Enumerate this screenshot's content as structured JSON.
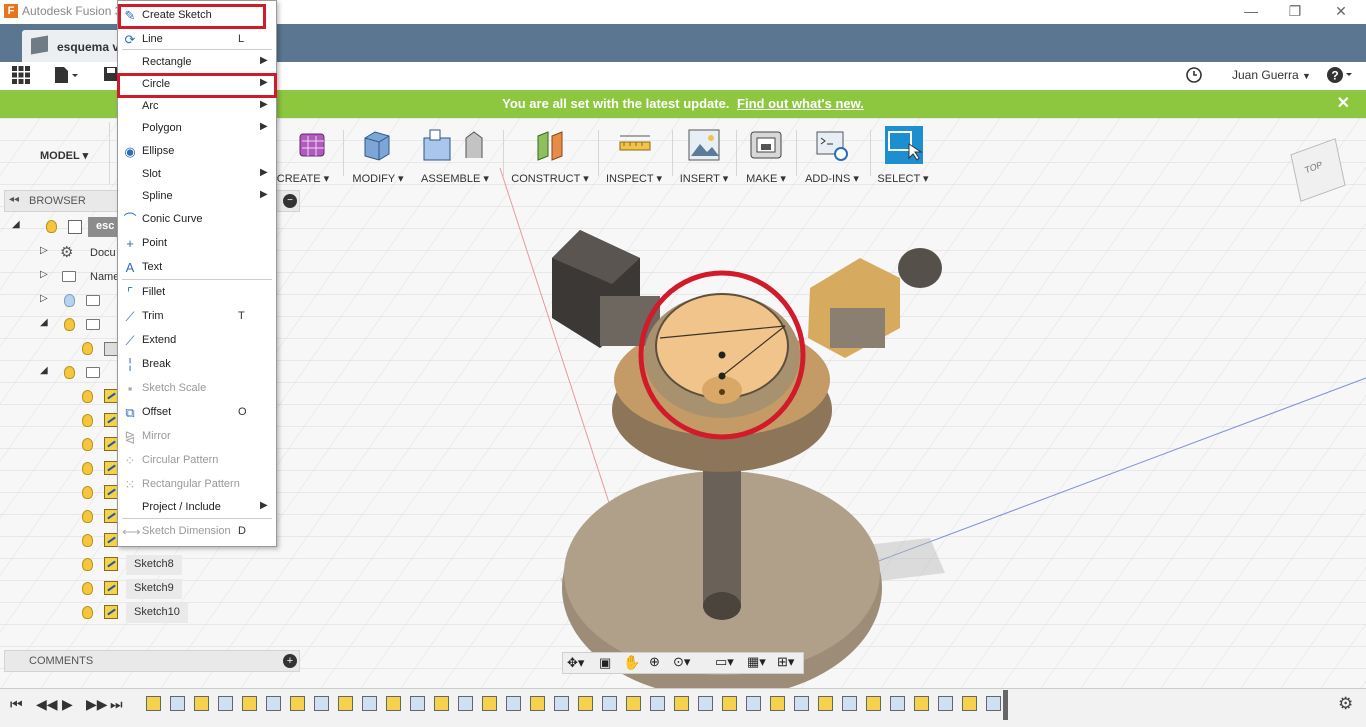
{
  "window": {
    "title": "Autodesk Fusion 360",
    "minimize_icon": "minimize-icon",
    "maximize_icon": "restore-icon",
    "close_icon": "close-icon"
  },
  "document_tab": {
    "label": "esquema v"
  },
  "quick_access": {
    "user_name": "Juan Guerra",
    "help_label": "?"
  },
  "banner": {
    "message": "You are all set with the latest update.",
    "link": "Find out what's new.",
    "close": "✕",
    "color": "#8dc63f"
  },
  "toolbar": {
    "workspace": "MODEL",
    "groups": [
      {
        "label": "CREATE"
      },
      {
        "label": "MODIFY"
      },
      {
        "label": "ASSEMBLE"
      },
      {
        "label": "CONSTRUCT"
      },
      {
        "label": "INSPECT"
      },
      {
        "label": "INSERT"
      },
      {
        "label": "MAKE"
      },
      {
        "label": "ADD-INS"
      },
      {
        "label": "SELECT"
      }
    ]
  },
  "browser": {
    "title": "BROWSER",
    "root_label": "esc",
    "rows": [
      {
        "label": "Docu"
      },
      {
        "label": "Name"
      }
    ],
    "sketches": [
      "Sketch8",
      "Sketch9",
      "Sketch10"
    ]
  },
  "comments": {
    "title": "COMMENTS"
  },
  "sketch_menu": {
    "items": [
      {
        "label": "Create Sketch",
        "shortcut": "",
        "submenu": false,
        "disabled": false,
        "icon": "create-sketch-icon",
        "highlighted": true
      },
      {
        "label": "Line",
        "shortcut": "L",
        "submenu": false,
        "disabled": false,
        "icon": "line-icon"
      },
      {
        "label": "Rectangle",
        "shortcut": "",
        "submenu": true,
        "disabled": false,
        "icon": "rectangle-icon"
      },
      {
        "label": "Circle",
        "shortcut": "",
        "submenu": true,
        "disabled": false,
        "icon": "circle-icon",
        "highlighted": true
      },
      {
        "label": "Arc",
        "shortcut": "",
        "submenu": true,
        "disabled": false,
        "icon": "arc-icon"
      },
      {
        "label": "Polygon",
        "shortcut": "",
        "submenu": true,
        "disabled": false,
        "icon": "polygon-icon"
      },
      {
        "label": "Ellipse",
        "shortcut": "",
        "submenu": false,
        "disabled": false,
        "icon": "ellipse-icon"
      },
      {
        "label": "Slot",
        "shortcut": "",
        "submenu": true,
        "disabled": false,
        "icon": "slot-icon"
      },
      {
        "label": "Spline",
        "shortcut": "",
        "submenu": true,
        "disabled": false,
        "icon": "spline-icon"
      },
      {
        "label": "Conic Curve",
        "shortcut": "",
        "submenu": false,
        "disabled": false,
        "icon": "conic-curve-icon"
      },
      {
        "label": "Point",
        "shortcut": "",
        "submenu": false,
        "disabled": false,
        "icon": "point-icon"
      },
      {
        "label": "Text",
        "shortcut": "",
        "submenu": false,
        "disabled": false,
        "icon": "text-icon"
      },
      {
        "label": "Fillet",
        "shortcut": "",
        "submenu": false,
        "disabled": false,
        "icon": "fillet-icon"
      },
      {
        "label": "Trim",
        "shortcut": "T",
        "submenu": false,
        "disabled": false,
        "icon": "trim-icon"
      },
      {
        "label": "Extend",
        "shortcut": "",
        "submenu": false,
        "disabled": false,
        "icon": "extend-icon"
      },
      {
        "label": "Break",
        "shortcut": "",
        "submenu": false,
        "disabled": false,
        "icon": "break-icon"
      },
      {
        "label": "Sketch Scale",
        "shortcut": "",
        "submenu": false,
        "disabled": true,
        "icon": "sketch-scale-icon"
      },
      {
        "label": "Offset",
        "shortcut": "O",
        "submenu": false,
        "disabled": false,
        "icon": "offset-icon"
      },
      {
        "label": "Mirror",
        "shortcut": "",
        "submenu": false,
        "disabled": true,
        "icon": "mirror-icon"
      },
      {
        "label": "Circular Pattern",
        "shortcut": "",
        "submenu": false,
        "disabled": true,
        "icon": "circular-pattern-icon"
      },
      {
        "label": "Rectangular Pattern",
        "shortcut": "",
        "submenu": false,
        "disabled": true,
        "icon": "rectangular-pattern-icon"
      },
      {
        "label": "Project / Include",
        "shortcut": "",
        "submenu": true,
        "disabled": false,
        "icon": ""
      },
      {
        "label": "Sketch Dimension",
        "shortcut": "D",
        "submenu": false,
        "disabled": true,
        "icon": "sketch-dimension-icon"
      }
    ]
  },
  "viewcube": {
    "label": "TOP"
  },
  "annotation_color": "#d11a2a"
}
